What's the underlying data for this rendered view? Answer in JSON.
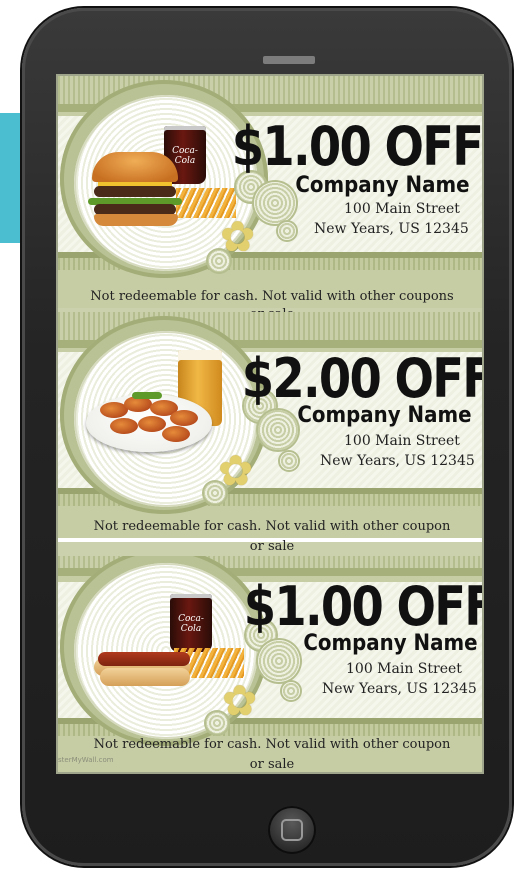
{
  "colors": {
    "phone_body": "#242424",
    "screen_background": "#cbd1ad",
    "accent_tab": "#4bbfd0",
    "text": "#111111"
  },
  "coupons": [
    {
      "discount": "$1.00 OFF",
      "company": "Company Name",
      "street": "100 Main Street",
      "city": "New Years, US 12345",
      "notice_line1": "Not redeemable for cash. Not valid with other coupons",
      "notice_line2": "or sale",
      "image": "burger-fries-cola-image"
    },
    {
      "discount": "$2.00 OFF",
      "company": "Company Name",
      "street": "100 Main Street",
      "city": "New Years, US 12345",
      "notice_line1": "Not redeemable for cash. Not valid with other coupon",
      "notice_line2": "or sale",
      "image": "chicken-wings-beer-image"
    },
    {
      "discount": "$1.00 OFF",
      "company": "Company Name",
      "street": "100 Main Street",
      "city": "New Years, US 12345",
      "notice_line1": "Not redeemable for cash. Not valid with other coupon",
      "notice_line2": "or sale",
      "image": "hotdog-fries-cola-image"
    }
  ],
  "cup_logo": "Coca-Cola",
  "watermark": "sterMyWall.com",
  "icons": {
    "home_button": "home-button-icon",
    "speaker": "speaker-grille-icon",
    "flower": "flower-decoration-icon"
  }
}
